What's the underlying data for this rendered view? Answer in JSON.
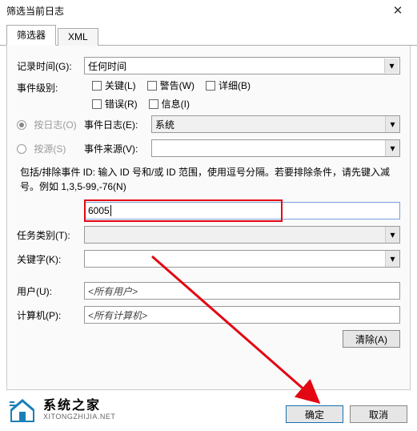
{
  "window": {
    "title": "筛选当前日志"
  },
  "tabs": {
    "filter": "筛选器",
    "xml": "XML"
  },
  "logged": {
    "label": "记录时间(G):",
    "value": "任何时间"
  },
  "event_level": {
    "label": "事件级别:",
    "critical": "关键(L)",
    "warning": "警告(W)",
    "verbose": "详细(B)",
    "error": "错误(R)",
    "info": "信息(I)"
  },
  "by_log": {
    "label": "按日志(O)",
    "sublabel": "事件日志(E):",
    "value": "系统"
  },
  "by_source": {
    "label": "按源(S)",
    "sublabel": "事件来源(V):"
  },
  "instruction": "包括/排除事件 ID: 输入 ID 号和/或 ID 范围，使用逗号分隔。若要排除条件，请先键入减号。例如 1,3,5-99,-76(N)",
  "id_input": "6005",
  "task_category": {
    "label": "任务类别(T):"
  },
  "keywords": {
    "label": "关键字(K):"
  },
  "user": {
    "label": "用户(U):",
    "value": "<所有用户>"
  },
  "computer": {
    "label": "计算机(P):",
    "value": "<所有计算机>"
  },
  "buttons": {
    "clear": "清除(A)",
    "ok": "确定",
    "cancel": "取消"
  },
  "watermark": {
    "cn": "系统之家",
    "en": "XITONGZHIJIA.NET"
  }
}
